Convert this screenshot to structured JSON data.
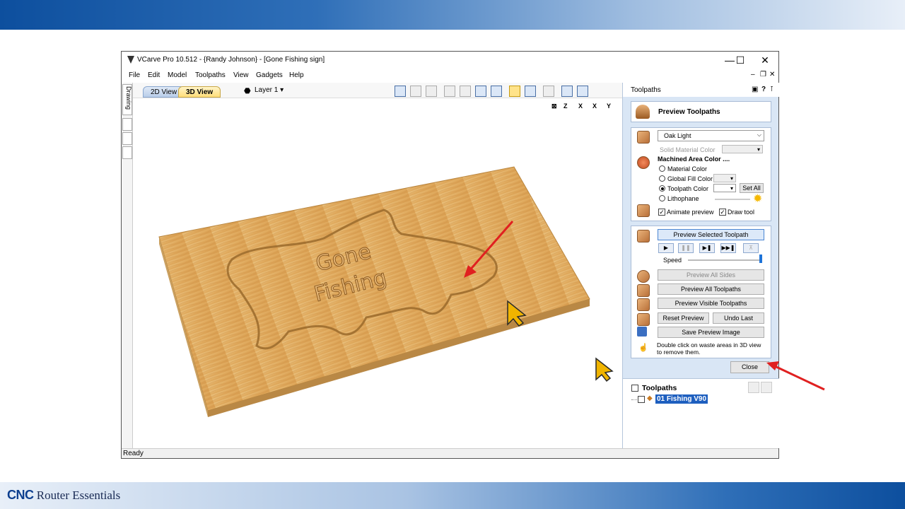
{
  "window": {
    "title": "VCarve Pro 10.512 - {Randy Johnson} - [Gone Fishing sign]",
    "controls": {
      "minimize": "—",
      "maximize": "☐",
      "close": "✕"
    },
    "mdi_controls": [
      "–",
      "❐",
      "✕"
    ]
  },
  "menu": [
    "File",
    "Edit",
    "Model",
    "Toolpaths",
    "View",
    "Gadgets",
    "Help"
  ],
  "left_tab": "Drawing",
  "view_tabs": {
    "tab_2d": "2D View",
    "tab_3d": "3D View"
  },
  "layer": {
    "label": "Layer 1"
  },
  "view3d": {
    "axis_labels": [
      "Z",
      "X",
      "X",
      "Y"
    ],
    "sign_text_line1": "Gone",
    "sign_text_line2": "Fishing"
  },
  "status": "Ready",
  "panel": {
    "header": "Toolpaths",
    "preview_title": "Preview Toolpaths",
    "material": "Oak Light",
    "solid_material_color": "Solid Material Color",
    "machined_area_color": "Machined Area Color ....",
    "radio_options": [
      "Material Color",
      "Global Fill Color",
      "Toolpath Color",
      "Lithophane"
    ],
    "selected_radio": "Toolpath Color",
    "set_all": "Set All",
    "animate_preview": "Animate preview",
    "draw_tool": "Draw tool",
    "preview_selected": "Preview Selected Toolpath",
    "speed": "Speed",
    "preview_all_sides": "Preview All Sides",
    "preview_all": "Preview All Toolpaths",
    "preview_visible": "Preview Visible Toolpaths",
    "reset_preview": "Reset Preview",
    "undo_last": "Undo Last",
    "save_preview": "Save Preview Image",
    "hint_line1": "Double click on waste areas in 3D view",
    "hint_line2": "to remove them.",
    "close": "Close",
    "toolpaths_list_title": "Toolpaths",
    "toolpath_item": "01 Fishing V90"
  },
  "brand": {
    "cnc": "CNC",
    "rest": " Router Essentials"
  },
  "colors": {
    "accent_blue": "#0d4f9e",
    "wood": "#e2b168",
    "highlight": "#1e5fbf",
    "arrow_red": "#e02020"
  }
}
